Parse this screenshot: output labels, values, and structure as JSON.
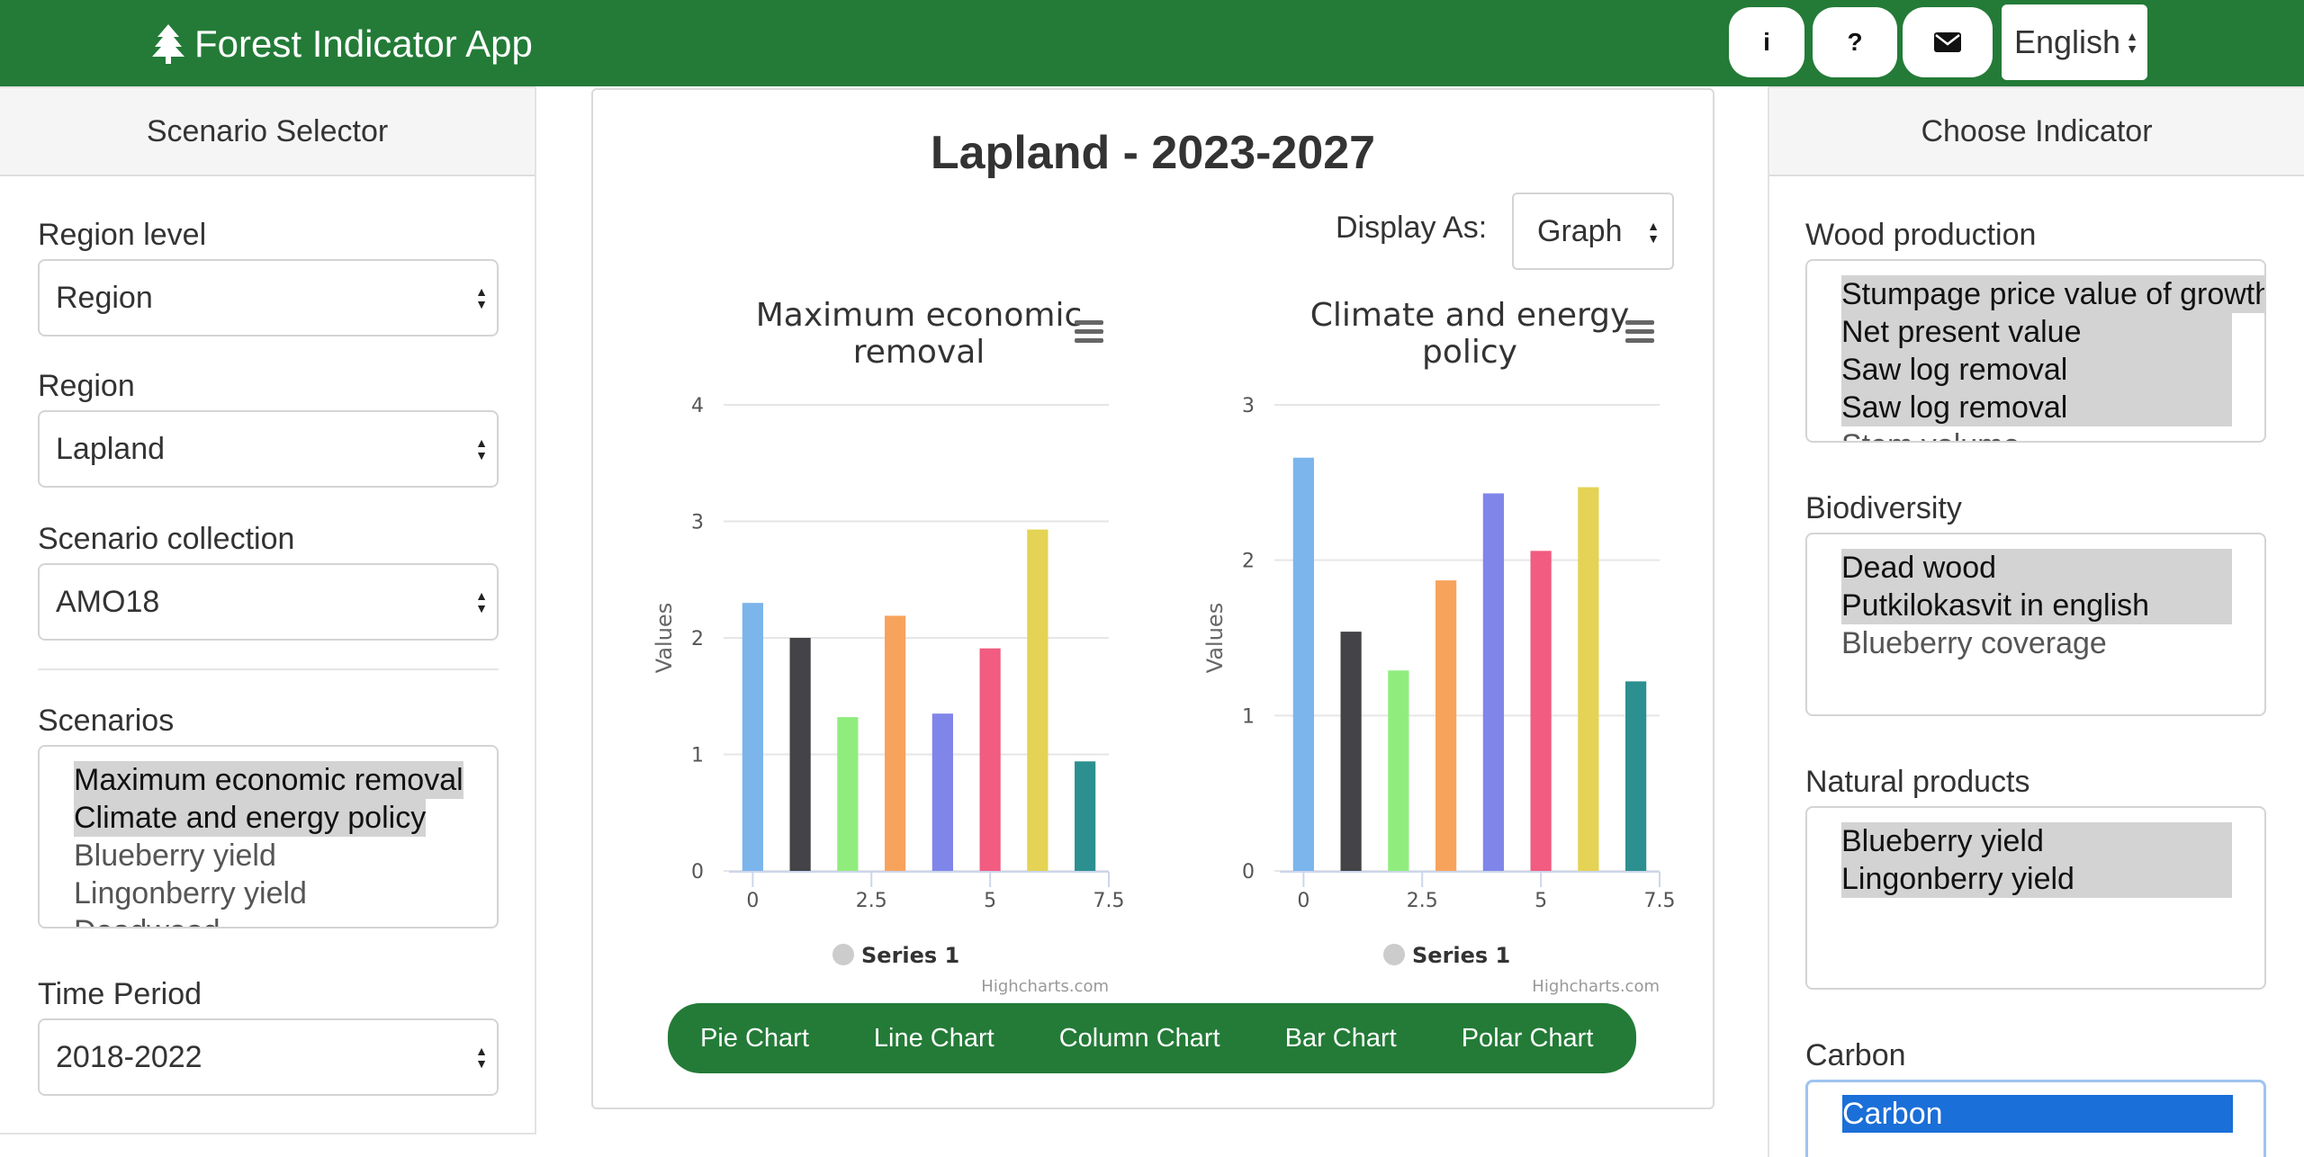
{
  "header": {
    "app_title": "Forest Indicator App",
    "buttons": [
      {
        "icon": "info-icon",
        "glyph": "i"
      },
      {
        "icon": "question-icon",
        "glyph": "?"
      },
      {
        "icon": "envelope-icon",
        "glyph": "✉"
      }
    ],
    "language": "English"
  },
  "scenario_selector": {
    "title": "Scenario Selector",
    "region_level_label": "Region level",
    "region_level_value": "Region",
    "region_label": "Region",
    "region_value": "Lapland",
    "collection_label": "Scenario collection",
    "collection_value": "AMO18",
    "scenarios_label": "Scenarios",
    "scenarios": [
      {
        "label": "Maximum economic removal",
        "selected": true
      },
      {
        "label": "Climate and energy policy",
        "selected": true
      },
      {
        "label": "Blueberry yield",
        "selected": false
      },
      {
        "label": "Lingonberry yield",
        "selected": false
      },
      {
        "label": "Deadwood",
        "selected": false
      }
    ],
    "time_period_label": "Time Period",
    "time_period_value": "2018-2022"
  },
  "main": {
    "title": "Lapland - 2023-2027",
    "display_as_label": "Display As:",
    "display_as_value": "Graph",
    "chart_buttons": [
      "Pie Chart",
      "Line Chart",
      "Column Chart",
      "Bar Chart",
      "Polar Chart"
    ]
  },
  "chart_data": [
    {
      "type": "bar",
      "title": "Maximum economic removal",
      "title_lines": [
        "Maximum economic",
        "removal"
      ],
      "ylabel": "Values",
      "ylim": [
        0,
        4
      ],
      "yticks": [
        0,
        1,
        2,
        3,
        4
      ],
      "xlim": [
        -0.5,
        7.5
      ],
      "xticks": [
        "0",
        "2.5",
        "5",
        "7.5"
      ],
      "xtick_values": [
        0,
        2.5,
        5,
        7.5
      ],
      "grid": true,
      "legend": "bottom-center",
      "x": [
        0,
        1,
        2,
        3,
        4,
        5,
        6,
        7
      ],
      "series": [
        {
          "name": "Series 1",
          "values": [
            2.3,
            2.0,
            1.32,
            2.19,
            1.35,
            1.91,
            2.93,
            0.94
          ]
        }
      ],
      "colors": [
        "#7cb5ec",
        "#434348",
        "#90ed7d",
        "#f7a35c",
        "#8085e9",
        "#f15c80",
        "#e4d354",
        "#2b908f"
      ],
      "credit": "Highcharts.com"
    },
    {
      "type": "bar",
      "title": "Climate and energy policy",
      "title_lines": [
        "Climate and energy",
        "policy"
      ],
      "ylabel": "Values",
      "ylim": [
        0,
        3
      ],
      "yticks": [
        0,
        1,
        2,
        3
      ],
      "xlim": [
        -0.5,
        7.5
      ],
      "xticks": [
        "0",
        "2.5",
        "5",
        "7.5"
      ],
      "xtick_values": [
        0,
        2.5,
        5,
        7.5
      ],
      "grid": true,
      "legend": "bottom-center",
      "x": [
        0,
        1,
        2,
        3,
        4,
        5,
        6,
        7
      ],
      "series": [
        {
          "name": "Series 1",
          "values": [
            2.66,
            1.54,
            1.29,
            1.87,
            2.43,
            2.06,
            2.47,
            1.22
          ]
        }
      ],
      "colors": [
        "#7cb5ec",
        "#434348",
        "#90ed7d",
        "#f7a35c",
        "#8085e9",
        "#f15c80",
        "#e4d354",
        "#2b908f"
      ],
      "credit": "Highcharts.com"
    }
  ],
  "indicator_panel": {
    "title": "Choose Indicator",
    "groups": [
      {
        "label": "Wood production",
        "items": [
          {
            "label": "Stumpage price value of growth",
            "selected": true
          },
          {
            "label": "Net present value",
            "selected": true
          },
          {
            "label": "Saw log removal",
            "selected": true
          },
          {
            "label": "Saw log removal",
            "selected": true
          },
          {
            "label": "Stem volume",
            "selected": false
          }
        ]
      },
      {
        "label": "Biodiversity",
        "items": [
          {
            "label": "Dead wood",
            "selected": true
          },
          {
            "label": "Putkilokasvit in english",
            "selected": true
          },
          {
            "label": "Blueberry coverage",
            "selected": false
          }
        ]
      },
      {
        "label": "Natural products",
        "items": [
          {
            "label": "Blueberry yield",
            "selected": true
          },
          {
            "label": "Lingonberry yield",
            "selected": true
          }
        ]
      },
      {
        "label": "Carbon",
        "items": [
          {
            "label": "Carbon",
            "selected": true
          }
        ]
      }
    ]
  },
  "theme": {
    "primary": "#237b37",
    "highlight": "#1a6fd8",
    "selected_bg": "#d3d3d3"
  }
}
